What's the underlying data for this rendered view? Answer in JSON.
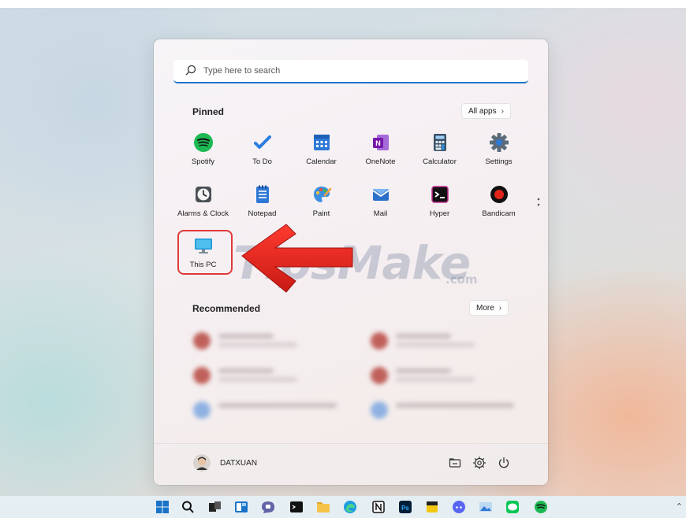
{
  "search": {
    "placeholder": "Type here to search"
  },
  "pinned": {
    "title": "Pinned",
    "all_apps_label": "All apps",
    "apps": [
      {
        "label": "Spotify",
        "icon": "spotify-icon"
      },
      {
        "label": "To Do",
        "icon": "todo-icon"
      },
      {
        "label": "Calendar",
        "icon": "calendar-icon"
      },
      {
        "label": "OneNote",
        "icon": "onenote-icon"
      },
      {
        "label": "Calculator",
        "icon": "calculator-icon"
      },
      {
        "label": "Settings",
        "icon": "settings-icon"
      },
      {
        "label": "Alarms & Clock",
        "icon": "alarms-clock-icon"
      },
      {
        "label": "Notepad",
        "icon": "notepad-icon"
      },
      {
        "label": "Paint",
        "icon": "paint-icon"
      },
      {
        "label": "Mail",
        "icon": "mail-icon"
      },
      {
        "label": "Hyper",
        "icon": "hyper-icon"
      },
      {
        "label": "Bandicam",
        "icon": "bandicam-icon"
      },
      {
        "label": "This PC",
        "icon": "this-pc-icon"
      }
    ]
  },
  "recommended": {
    "title": "Recommended",
    "more_label": "More"
  },
  "user": {
    "name": "DATXUAN"
  },
  "watermark": {
    "text": "TipsMake",
    "domain": ".com"
  },
  "colors": {
    "accent": "#1a73c8",
    "highlight": "#e03a3a",
    "arrow": "#e52a2a"
  }
}
